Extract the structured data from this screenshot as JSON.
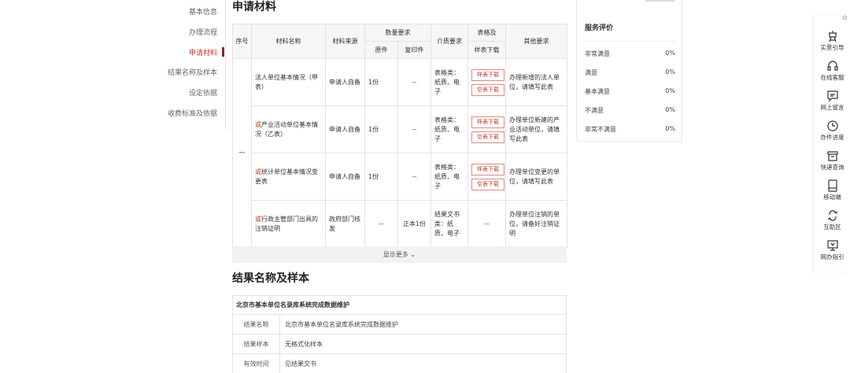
{
  "nav": {
    "items": [
      {
        "label": "基本信息",
        "active": false
      },
      {
        "label": "办理流程",
        "active": false
      },
      {
        "label": "申请材料",
        "active": true
      },
      {
        "label": "结果名称及样本",
        "active": false
      },
      {
        "label": "设定依据",
        "active": false
      },
      {
        "label": "收费标准及依据",
        "active": false
      }
    ]
  },
  "materials": {
    "title": "申请材料",
    "headers": {
      "index": "序号",
      "name": "材料名称",
      "source": "材料来源",
      "qty": "数量要求",
      "qty_original": "原件",
      "qty_copy": "复印件",
      "medium": "介质要求",
      "form": "表格及",
      "form_sub": "样表下载",
      "other": "其他要求"
    },
    "group_index": "一",
    "rows": [
      {
        "prefix": "",
        "name": "法人单位基本情况（甲表）",
        "source": "申请人自备",
        "original": "1份",
        "copy": "--",
        "medium": "表格类：纸质、电子",
        "downloads": [
          "样表下载",
          "空表下载"
        ],
        "other": "办理新增的法人单位，请填写此表"
      },
      {
        "prefix": "或",
        "name": "产业活动单位基本情况（乙表）",
        "source": "申请人自备",
        "original": "1份",
        "copy": "--",
        "medium": "表格类：纸质、电子",
        "downloads": [
          "样表下载",
          "空表下载"
        ],
        "other": "办理单位新建的产业活动单位，请填写此表"
      },
      {
        "prefix": "或",
        "name": "统计单位基本情况变更表",
        "source": "申请人自备",
        "original": "1份",
        "copy": "--",
        "medium": "表格类：纸质、电子",
        "downloads": [
          "样表下载",
          "空表下载"
        ],
        "other": "办理单位变更的单位，请填写此表"
      },
      {
        "prefix": "或",
        "name": "行政主管部门出具的注销证明",
        "source": "政府部门核发",
        "original": "--",
        "copy": "正本1份",
        "medium": "结果文书类：纸质、电子",
        "downloads": [],
        "form_dash": "--",
        "other": "办理单位注销的单位，请备好注销证明"
      }
    ],
    "show_more": "显示更多 ⌄"
  },
  "result": {
    "title": "结果名称及样本",
    "header": "北京市基本单位名录库系统完成数据维护",
    "rows": [
      {
        "label": "结果名称",
        "value": "北京市基本单位名录库系统完成数据维护"
      },
      {
        "label": "结果样本",
        "value": "无格式化样本"
      },
      {
        "label": "有效时间",
        "value": "见结果文书"
      }
    ]
  },
  "rating": {
    "title": "服务评价",
    "rows": [
      {
        "label": "非常满意",
        "value": "0%"
      },
      {
        "label": "满意",
        "value": "0%"
      },
      {
        "label": "基本满意",
        "value": "0%"
      },
      {
        "label": "不满意",
        "value": "0%"
      },
      {
        "label": "非常不满意",
        "value": "0%"
      }
    ]
  },
  "toolbar": {
    "items": [
      {
        "label": "实景引导",
        "icon": "guide-icon"
      },
      {
        "label": "在线客服",
        "icon": "headset-icon"
      },
      {
        "label": "网上留言",
        "icon": "message-icon"
      },
      {
        "label": "办件进度",
        "icon": "progress-icon"
      },
      {
        "label": "快递查询",
        "icon": "delivery-icon"
      },
      {
        "label": "移动端",
        "icon": "mobile-icon"
      },
      {
        "label": "互助区",
        "icon": "community-icon"
      },
      {
        "label": "网办指引",
        "icon": "screen-guide-icon"
      }
    ]
  },
  "colors": {
    "accent": "#c0392b",
    "marker": "#9b1c1c"
  }
}
